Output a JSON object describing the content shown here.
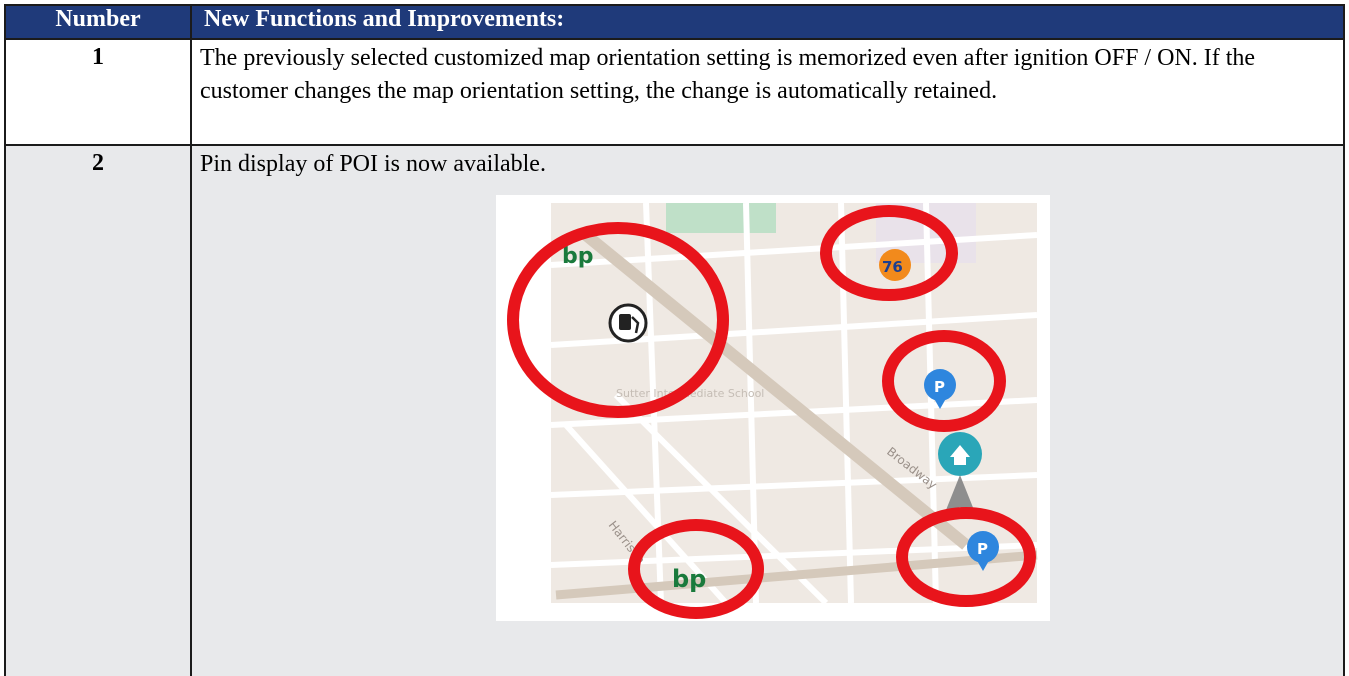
{
  "table": {
    "headers": {
      "number": "Number",
      "description": "New Functions and Improvements:"
    },
    "rows": [
      {
        "number": "1",
        "text": "The previously selected customized map orientation setting is memorized even after ignition OFF / ON.  If the customer changes the map orientation setting, the change is automatically retained."
      },
      {
        "number": "2",
        "text": "Pin display of POI is now available."
      }
    ]
  },
  "map": {
    "street_labels": {
      "school": "Sutter Intermediate School",
      "broadway": "Broadway",
      "harrison": "Harrison"
    },
    "poi_labels": {
      "bp_top": "bp",
      "bp_bottom": "bp",
      "station_76": "76",
      "parking_1": "P",
      "parking_2": "P"
    },
    "colors": {
      "header_bg": "#1f3a7a",
      "row_alt_bg": "#e8e9eb",
      "highlight_circle": "#e8141b",
      "parking_pin": "#2e86de",
      "home_pin": "#2aa6b8",
      "bp_green": "#1a7a3c",
      "station_76_orange": "#f28a1c"
    }
  }
}
